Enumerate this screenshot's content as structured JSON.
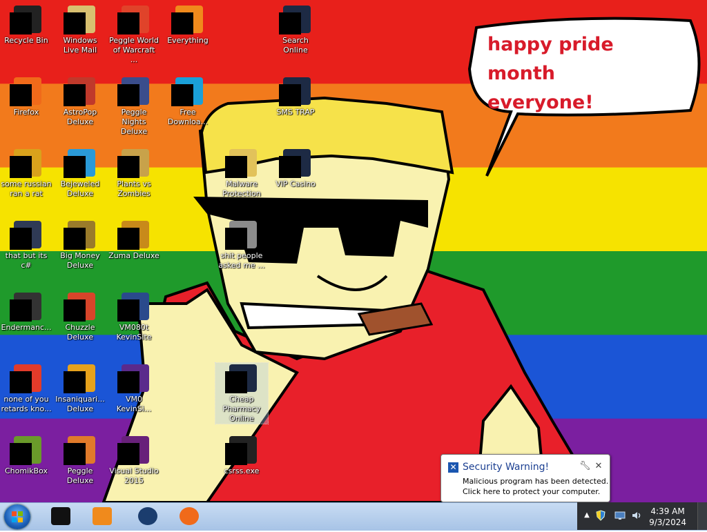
{
  "wallpaper": {
    "bands": [
      "#e8201b",
      "#f27a1c",
      "#f6e300",
      "#1f9a2b",
      "#1b55d6",
      "#7b1fa0"
    ],
    "speech_text": "happy pride month everyone!",
    "speech_lines": [
      "happy pride month",
      "everyone!"
    ]
  },
  "desktop_icons": [
    {
      "label": "Recycle Bin",
      "icon": "recycle-bin-icon",
      "color": "#222222"
    },
    {
      "label": "Windows Live Mail",
      "icon": "mail-icon",
      "color": "#d8c070"
    },
    {
      "label": "Peggle World of Warcraft ...",
      "icon": "peggle-icon",
      "color": "#e0432a"
    },
    {
      "label": "Everything",
      "icon": "search-app-icon",
      "color": "#f08a1c"
    },
    {
      "label": "Search Online",
      "icon": "globe-icon",
      "color": "#1d2a44"
    },
    {
      "label": "Firefox",
      "icon": "firefox-icon",
      "color": "#f06a1a"
    },
    {
      "label": "AstroPop Deluxe",
      "icon": "astropop-icon",
      "color": "#c0392b"
    },
    {
      "label": "Peggle Nights Deluxe",
      "icon": "peggle-nights-icon",
      "color": "#3a4d8c"
    },
    {
      "label": "Free Downloa...",
      "icon": "download-icon",
      "color": "#1aa0d8"
    },
    {
      "label": "SMS TRAP",
      "icon": "sms-icon",
      "color": "#1d2a44"
    },
    {
      "label": "some russian ran a rat",
      "icon": "ie-icon",
      "color": "#d9a21c"
    },
    {
      "label": "Bejeweled Deluxe",
      "icon": "bejeweled-icon",
      "color": "#2a9ad8"
    },
    {
      "label": "Plants vs Zombies",
      "icon": "pvz-icon",
      "color": "#c8a24a"
    },
    {
      "label": "Malware Protection",
      "icon": "shield-icon",
      "color": "#e2c25a"
    },
    {
      "label": "VIP Casino",
      "icon": "casino-icon",
      "color": "#1d2a44"
    },
    {
      "label": "that but its c#",
      "icon": "copy-icon",
      "color": "#2f3a55"
    },
    {
      "label": "Big Money Deluxe",
      "icon": "money-bag-icon",
      "color": "#9a7b2a"
    },
    {
      "label": "Zuma Deluxe",
      "icon": "zuma-icon",
      "color": "#c88a1a"
    },
    {
      "label": "shit people asked me ...",
      "icon": "folder-icon",
      "color": "#8c8c8c"
    },
    {
      "label": "Endermanc...",
      "icon": "terminal-icon",
      "color": "#333333"
    },
    {
      "label": "Chuzzle Deluxe",
      "icon": "chuzzle-icon",
      "color": "#d8452a"
    },
    {
      "label": "VM080t KevinSite",
      "icon": "vm-icon",
      "color": "#2a4a8c"
    },
    {
      "label": "Cheap Pharmacy Online",
      "icon": "pharmacy-icon",
      "color": "#1d2a44"
    },
    {
      "label": "none of you retards kno...",
      "icon": "arrow-app-icon",
      "color": "#e23b2a"
    },
    {
      "label": "Insaniquari... Deluxe",
      "icon": "insaniquarium-icon",
      "color": "#e6a21c"
    },
    {
      "label": "VM0 KevinSi...",
      "icon": "vm2-icon",
      "color": "#5a2a8c"
    },
    {
      "label": "ChomikBox",
      "icon": "chomikbox-icon",
      "color": "#6a9a2a"
    },
    {
      "label": "Peggle Deluxe",
      "icon": "peggle-deluxe-icon",
      "color": "#e07a2a"
    },
    {
      "label": "Visual Studio 2015",
      "icon": "visual-studio-icon",
      "color": "#68217a"
    },
    {
      "label": "csrss.exe",
      "icon": "console-icon",
      "color": "#222222"
    }
  ],
  "security_popup": {
    "title": "Security Warning!",
    "line1": "Malicious program has been detected.",
    "line2": "Click here to protect your computer."
  },
  "taskbar": {
    "pinned": [
      {
        "name": "black-app-icon",
        "color": "#111111"
      },
      {
        "name": "media-player-icon",
        "color": "#f08a1c"
      },
      {
        "name": "globe-app-icon",
        "color": "#1b3d6e"
      },
      {
        "name": "firefox-taskbar-icon",
        "color": "#f06a1a"
      }
    ],
    "time": "4:39 AM",
    "date": "9/3/2024"
  }
}
